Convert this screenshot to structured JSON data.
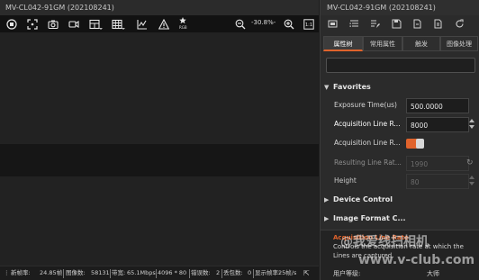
{
  "viewer": {
    "title": "MV-CL042-91GM (202108241)",
    "toolbar": {
      "icons": [
        "stop-icon",
        "fullscreen-icon",
        "camera-snapshot-icon",
        "video-record-icon",
        "layout-split-icon",
        "grid-icon",
        "histogram-icon",
        "warning-icon",
        "rgb-icon",
        "zoom-out-icon",
        "zoom-in-icon",
        "actual-size-icon"
      ],
      "rgb_label": "RGB",
      "zoom": "-30.8%-"
    },
    "status": {
      "items": [
        "新帧率:",
        "24.85帧",
        "图像数:",
        "58131",
        "带宽:",
        "65.1Mbps",
        "4096 * 80",
        "错误数:",
        "2",
        "丢包数:",
        "0",
        "显示帧率:",
        "25帧/s"
      ]
    }
  },
  "panel": {
    "title": "MV-CL042-91GM (202108241)",
    "toolbar_icons": [
      "device-icon",
      "list-icon",
      "list-edit-icon",
      "save-icon",
      "import-icon",
      "export-icon",
      "refresh-icon"
    ],
    "tabs": [
      "属性树",
      "常用属性",
      "触发",
      "图像处理"
    ],
    "active_tab": 0,
    "search_placeholder": "",
    "sections": {
      "favorites": "Favorites",
      "device_control": "Device Control",
      "image_format": "Image Format C..."
    },
    "properties": [
      {
        "name": "Exposure Time(us)",
        "value": "500.0000",
        "disabled": false
      },
      {
        "name": "Acquisition Line R...",
        "value": "8000",
        "disabled": false
      },
      {
        "name": "Acquisition Line R...",
        "value": "",
        "toggle": true,
        "disabled": false
      },
      {
        "name": "Resulting Line Rat...",
        "value": "1990",
        "disabled": true
      },
      {
        "name": "Height",
        "value": "80",
        "disabled": true
      }
    ],
    "description": {
      "title": "Acquisition Line Rate",
      "text": "Controls the acquisition rate at which the Lines are captured.",
      "user_level_label": "用户等级:",
      "user_level_value": "大师"
    },
    "watermark": {
      "line1": "@我爱线扫相机",
      "line2": "www.v-club.com"
    },
    "accent_color": "#e0632c"
  }
}
